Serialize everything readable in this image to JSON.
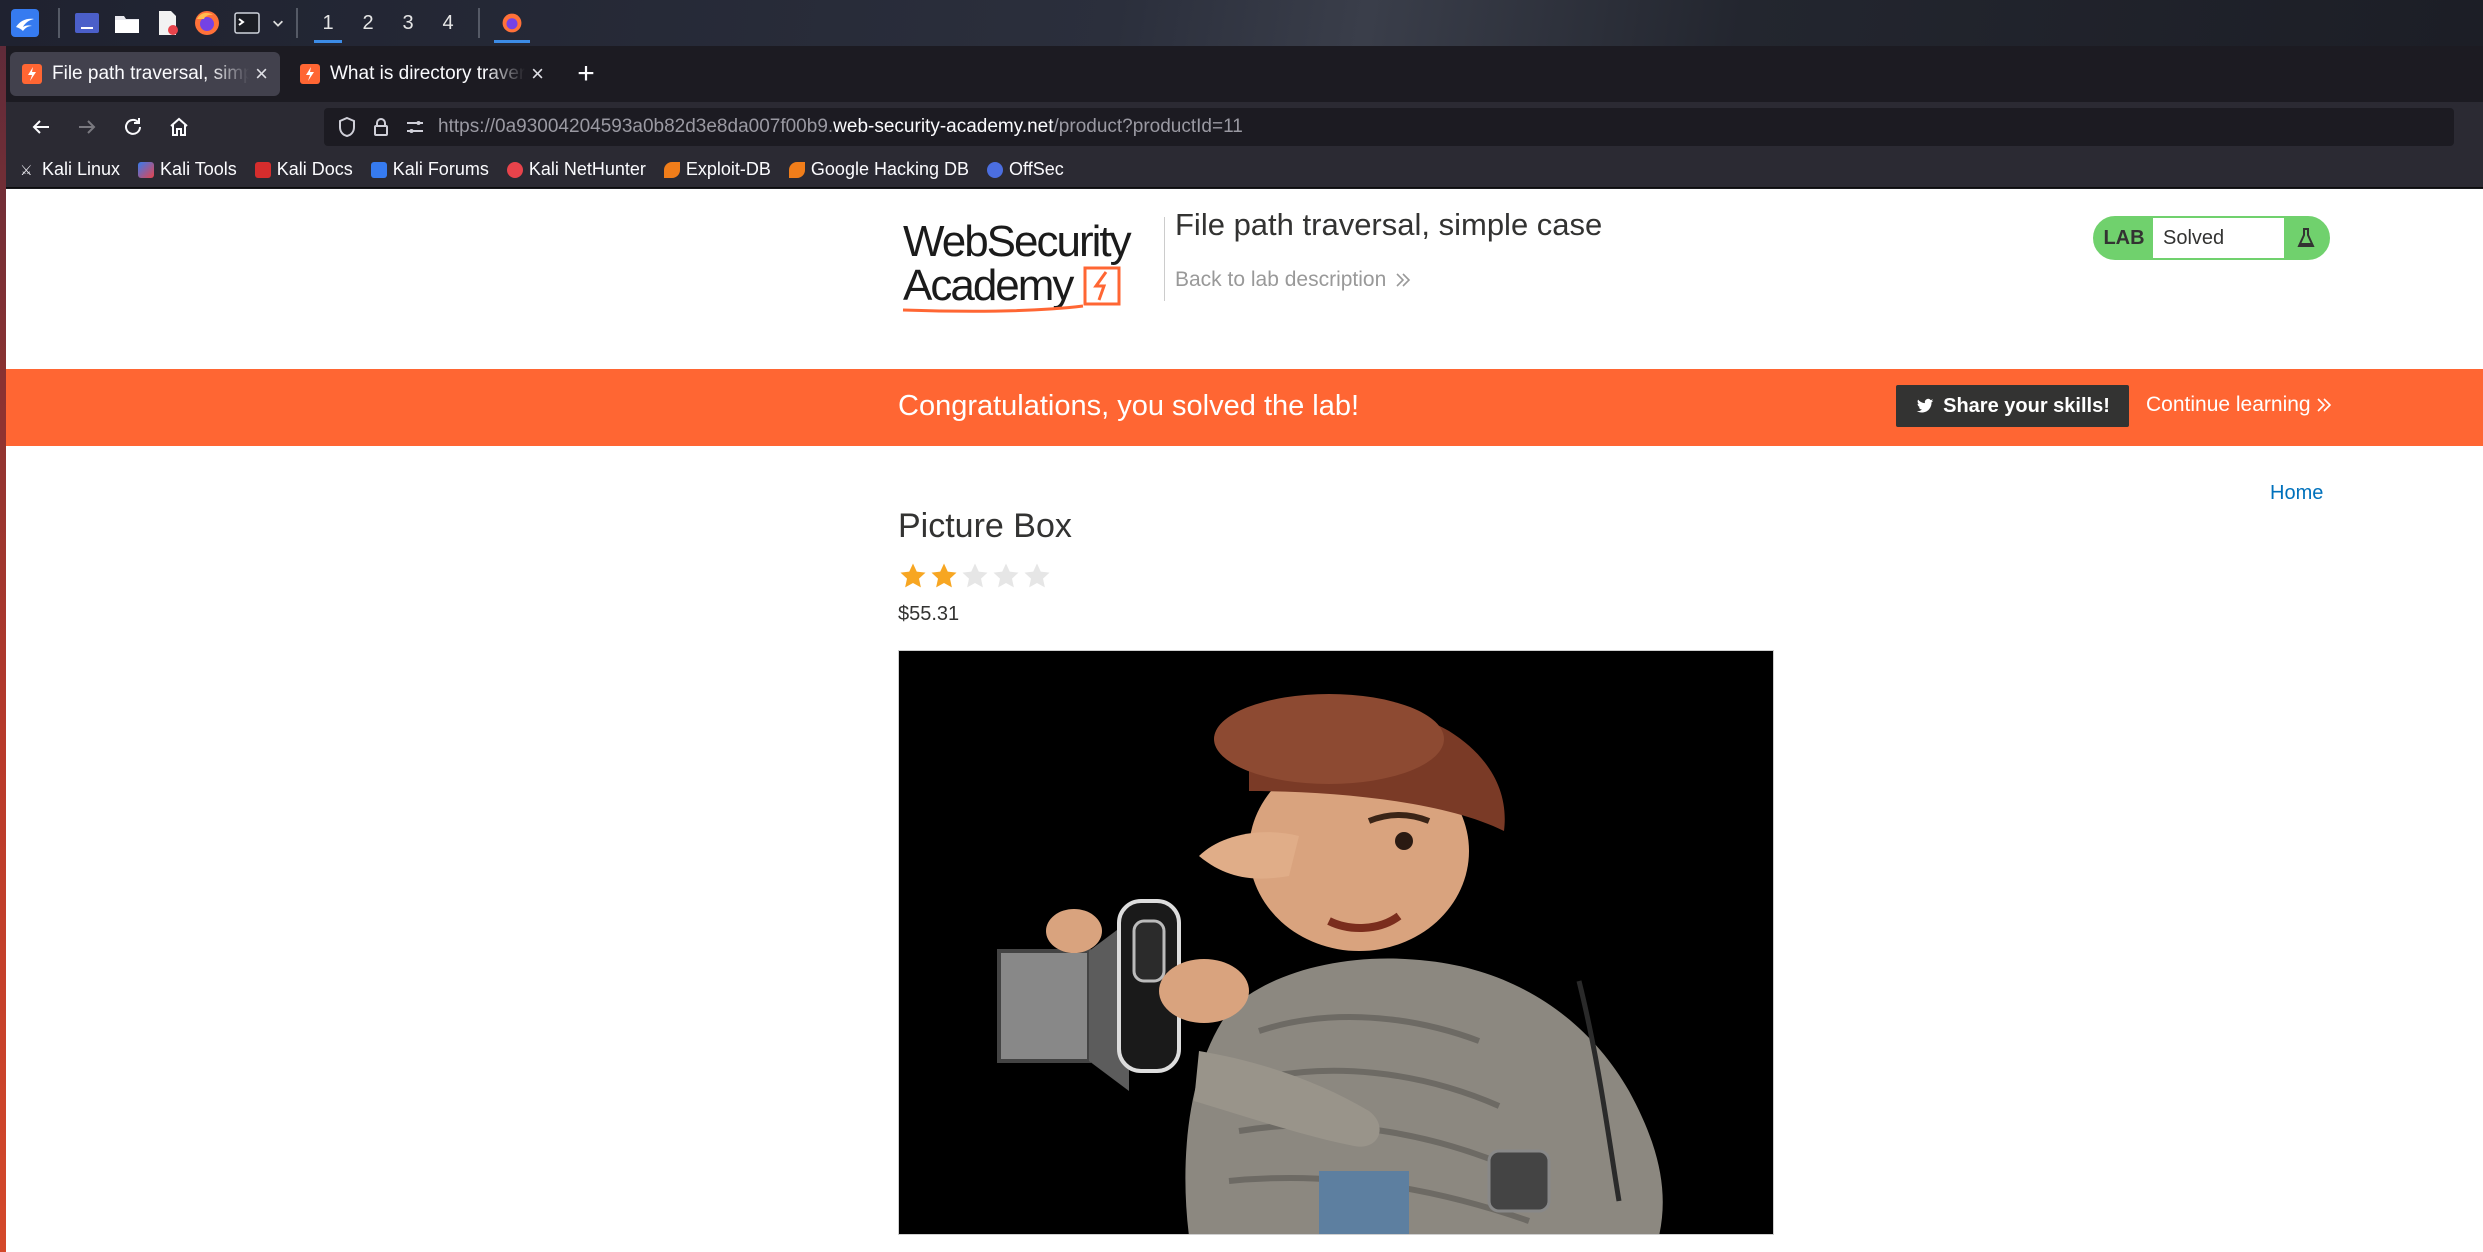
{
  "desktop": {
    "workspaces": [
      "1",
      "2",
      "3",
      "4"
    ],
    "active_workspace": "1"
  },
  "browser": {
    "tabs": [
      {
        "title": "File path traversal, simple case",
        "active": true
      },
      {
        "title": "What is directory traversal",
        "active": false
      }
    ],
    "url": {
      "prefix": "https://0a93004204593a0b82d3e8da007f00b9.",
      "host": "web-security-academy.net",
      "path": "/product?productId=11"
    },
    "bookmarks": [
      {
        "label": "Kali Linux",
        "icon": "kali-dragon-icon",
        "color": "#367bf0"
      },
      {
        "label": "Kali Tools",
        "icon": "kali-tools-icon",
        "color": "#e8434b"
      },
      {
        "label": "Kali Docs",
        "icon": "kali-docs-icon",
        "color": "#d62d2d"
      },
      {
        "label": "Kali Forums",
        "icon": "kali-forums-icon",
        "color": "#367bf0"
      },
      {
        "label": "Kali NetHunter",
        "icon": "nethunter-icon",
        "color": "#e8434b"
      },
      {
        "label": "Exploit-DB",
        "icon": "exploit-db-icon",
        "color": "#f07d1a"
      },
      {
        "label": "Google Hacking DB",
        "icon": "ghdb-icon",
        "color": "#f07d1a"
      },
      {
        "label": "OffSec",
        "icon": "offsec-icon",
        "color": "#4b6ee0"
      }
    ]
  },
  "page": {
    "logo": {
      "line1": "WebSecurity",
      "line2": "Academy"
    },
    "lab_title": "File path traversal, simple case",
    "back_link": "Back to lab description",
    "lab_status": {
      "label": "LAB",
      "value": "Solved",
      "color": "#70d16d"
    },
    "banner": {
      "message": "Congratulations, you solved the lab!",
      "share": "Share your skills!",
      "continue": "Continue learning",
      "color": "#ff6633"
    },
    "nav": {
      "home": "Home"
    },
    "product": {
      "name": "Picture Box",
      "rating": 2,
      "rating_max": 5,
      "price": "$55.31"
    }
  }
}
